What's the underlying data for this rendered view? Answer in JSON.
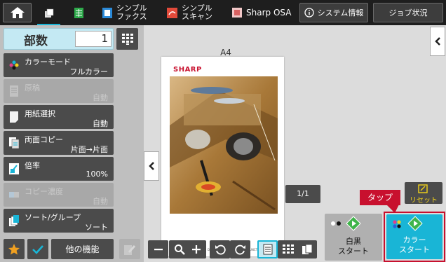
{
  "topbar": {
    "simple_fax": [
      "シンプル",
      "ファクス"
    ],
    "simple_scan": [
      "シンプル",
      "スキャン"
    ],
    "sharp_osa": "Sharp OSA",
    "system_info": "システム情報",
    "job_status": "ジョブ状況"
  },
  "copies": {
    "label": "部数",
    "value": "1"
  },
  "settings": [
    {
      "label": "カラーモード",
      "value": "フルカラー"
    },
    {
      "label": "原稿",
      "value": "自動"
    },
    {
      "label": "用紙選択",
      "value": "自動"
    },
    {
      "label": "両面コピー",
      "value": "片面→片面"
    },
    {
      "label": "倍率",
      "value": "100%"
    },
    {
      "label": "コピー濃度",
      "value": "自動"
    },
    {
      "label": "ソート/グループ",
      "value": "ソート"
    }
  ],
  "bottom": {
    "other_functions": "他の機能"
  },
  "preview": {
    "paper_size": "A4",
    "page_counter": "1/1",
    "doc_brand": "SHARP",
    "doc_caption": "DIGITAL FULL COLOUR MULTIFUNCTIONAL SYSTEM"
  },
  "actions": {
    "reset": "リセット",
    "bw_start": [
      "白黒",
      "スタート"
    ],
    "color_start": [
      "カラー",
      "スタート"
    ],
    "tap_callout": "タップ"
  },
  "colors": {
    "accent_cyan": "#19b5d6",
    "highlight_red": "#c8102e",
    "button_dark": "#4b4b4b",
    "topbar": "#1e1e1e"
  }
}
